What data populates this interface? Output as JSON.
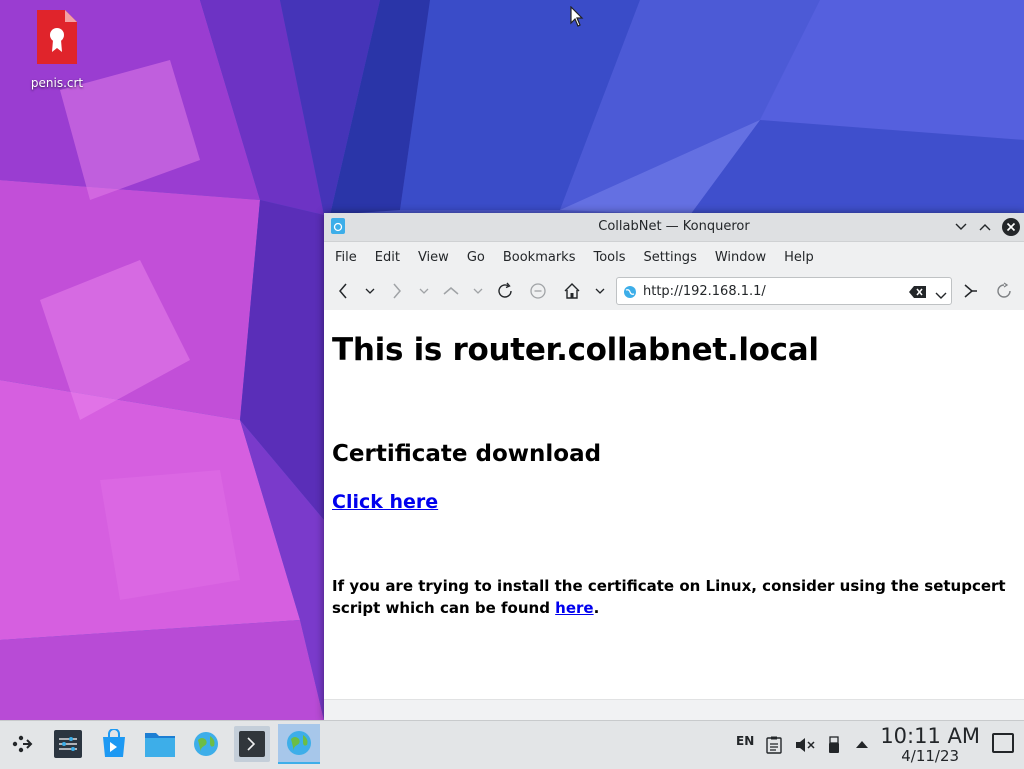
{
  "desktop": {
    "icons": [
      {
        "label": "penis.crt",
        "icon": "certificate-file-icon"
      }
    ]
  },
  "window": {
    "title": "CollabNet — Konqueror",
    "menu": [
      "File",
      "Edit",
      "View",
      "Go",
      "Bookmarks",
      "Tools",
      "Settings",
      "Window",
      "Help"
    ],
    "url": "http://192.168.1.1/"
  },
  "page": {
    "heading": "This is router.collabnet.local",
    "subheading": "Certificate download",
    "download_link": "Click here",
    "note_text": "If you are trying to install the certificate on Linux, consider using the setupcert script which can be found",
    "note_link": "here",
    "note_end": "."
  },
  "taskbar": {
    "apps": [
      "application-launcher-icon",
      "system-settings-icon",
      "discover-store-icon",
      "file-manager-icon",
      "web-browser-icon",
      "terminal-icon",
      "konqueror-icon"
    ],
    "tray": {
      "keyboard_layout": "EN",
      "icons": [
        "clipboard-icon",
        "volume-muted-icon",
        "usb-device-icon",
        "expand-tray-icon"
      ]
    },
    "clock": {
      "time": "10:11 AM",
      "date": "4/11/23"
    }
  },
  "colors": {
    "link": "#0000ee",
    "titlebar": "#dee0e2",
    "taskbar": "#e3e5e7",
    "accent": "#3daee9"
  }
}
